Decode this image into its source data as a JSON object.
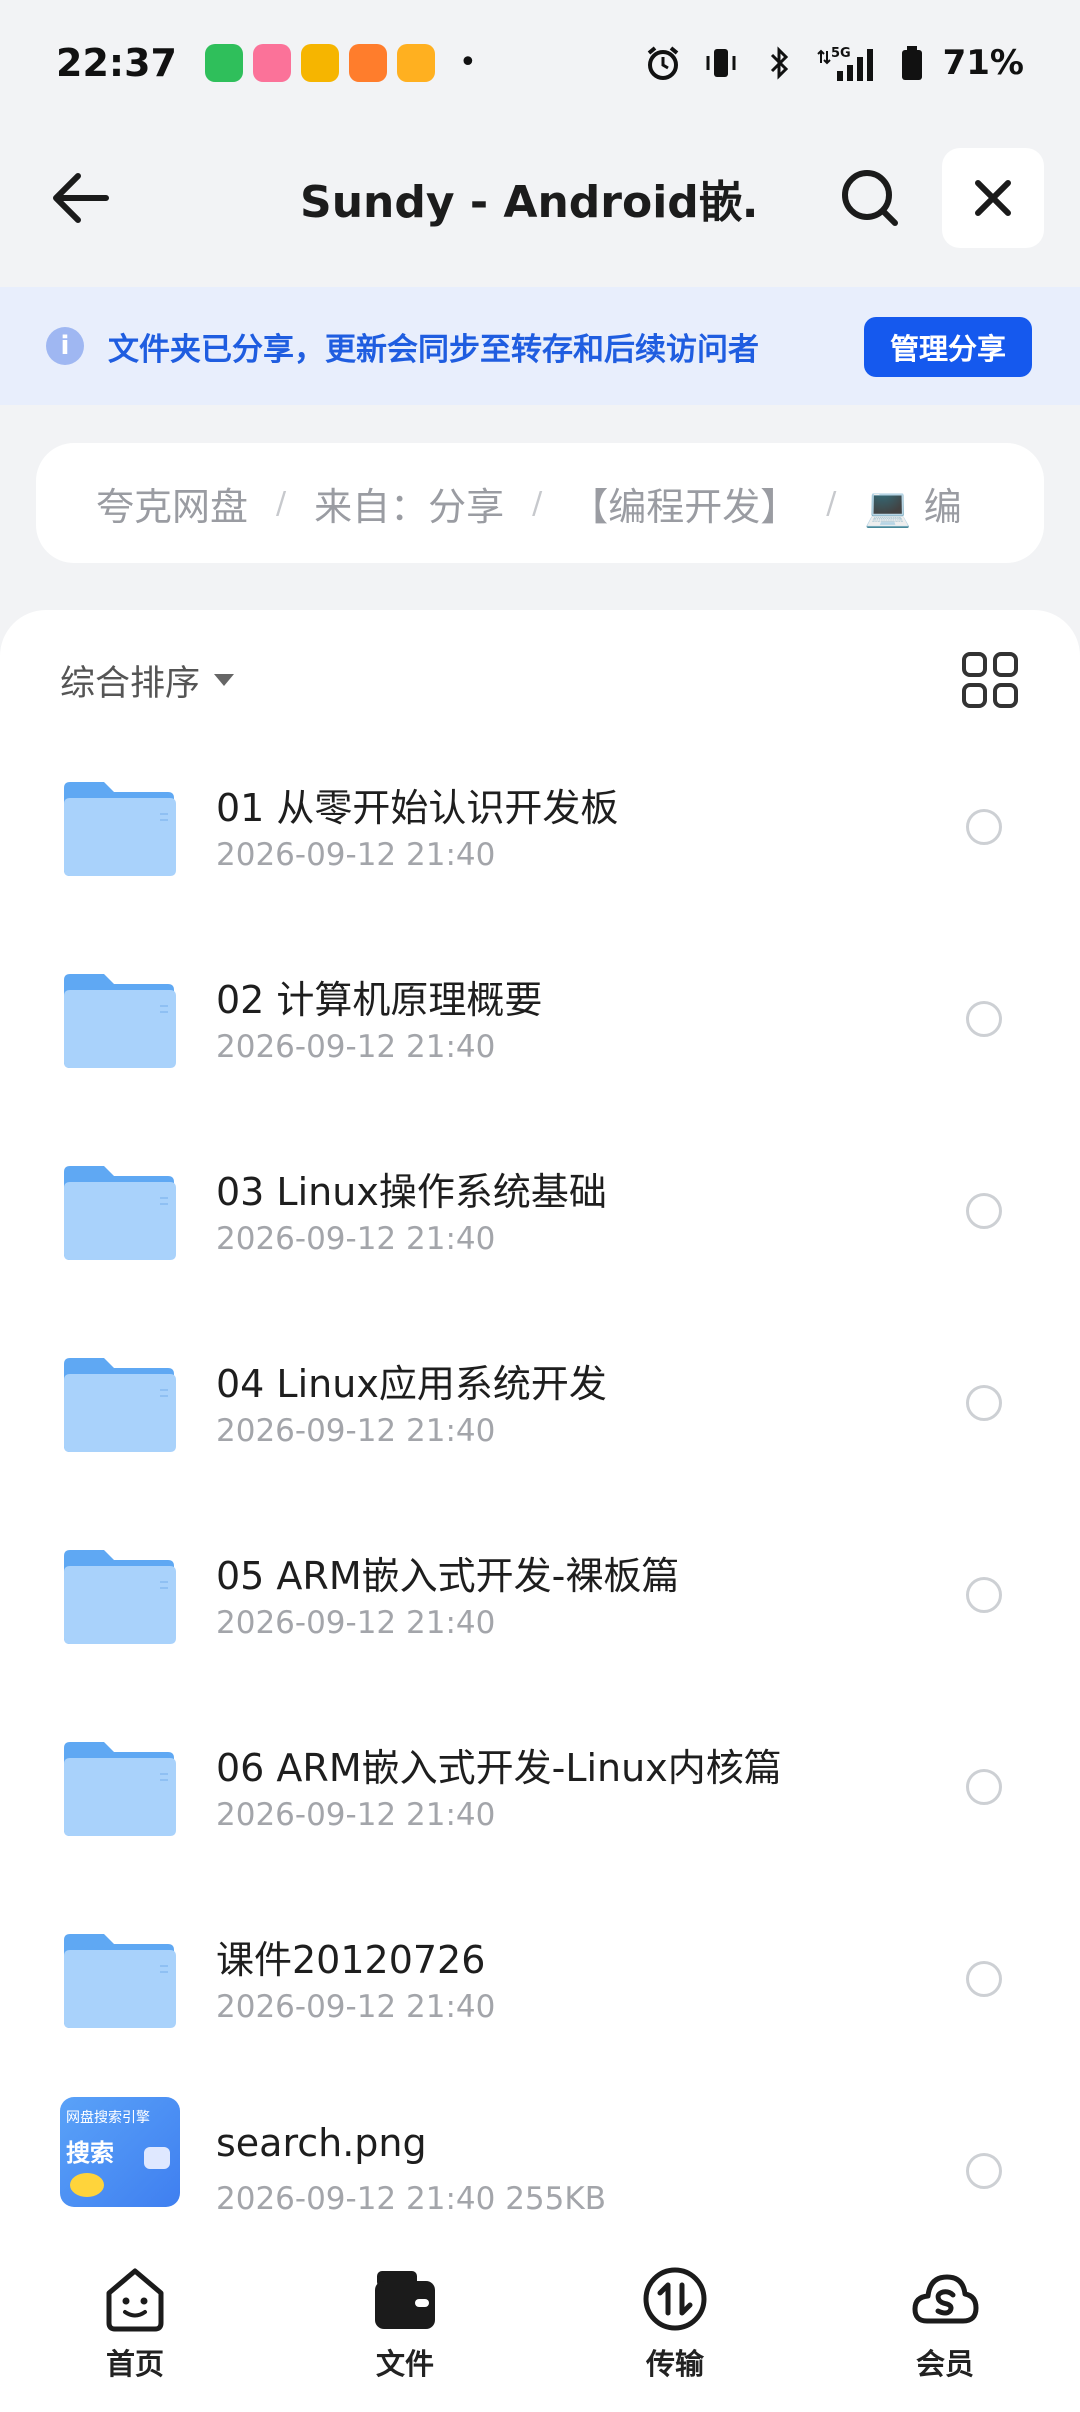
{
  "status_bar": {
    "time": "22:37",
    "battery": "71%",
    "network": "5G",
    "more": "•",
    "app_icons": [
      {
        "icon": "video-app-icon",
        "color": "#2fbf5b"
      },
      {
        "icon": "bilibili-app-icon",
        "color": "#fb7299"
      },
      {
        "icon": "fox-app-icon",
        "color": "#f6b500"
      },
      {
        "icon": "orange-app-icon",
        "color": "#ff7d2c"
      },
      {
        "icon": "play-app-icon",
        "color": "#ffb020"
      }
    ]
  },
  "nav": {
    "title": "Sundy - Android嵌…"
  },
  "share_banner": {
    "info_glyph": "i",
    "text": "文件夹已分享，更新会同步至转存和后续访问者",
    "manage_label": "管理分享"
  },
  "breadcrumb": {
    "items": [
      "夸克网盘",
      "来自：分享",
      "【编程开发】",
      "💻 编"
    ],
    "separator": "/"
  },
  "toolbar": {
    "sort_label": "综合排序"
  },
  "files": [
    {
      "name": "01 从零开始认识开发板",
      "meta": "2026-09-12 21:40",
      "type": "folder"
    },
    {
      "name": "02 计算机原理概要",
      "meta": "2026-09-12 21:40",
      "type": "folder"
    },
    {
      "name": "03 Linux操作系统基础",
      "meta": "2026-09-12 21:40",
      "type": "folder"
    },
    {
      "name": "04 Linux应用系统开发",
      "meta": "2026-09-12 21:40",
      "type": "folder"
    },
    {
      "name": "05 ARM嵌入式开发-裸板篇",
      "meta": "2026-09-12 21:40",
      "type": "folder"
    },
    {
      "name": "06 ARM嵌入式开发-Linux内核篇",
      "meta": "2026-09-12 21:40",
      "type": "folder"
    },
    {
      "name": "课件20120726",
      "meta": "2026-09-12 21:40",
      "type": "folder"
    },
    {
      "name": "search.png",
      "meta": "2026-09-12 21:40  255KB",
      "type": "image",
      "thumb_lines": [
        "网盘搜索引擎",
        "搜索"
      ]
    }
  ],
  "tabs": [
    {
      "label": "首页",
      "icon": "home-face-icon"
    },
    {
      "label": "文件",
      "icon": "wallet-folder-icon"
    },
    {
      "label": "传输",
      "icon": "transfer-arrows-icon"
    },
    {
      "label": "会员",
      "icon": "cloud-s-icon"
    }
  ],
  "colors": {
    "accent": "#1559ee",
    "banner_bg": "#e8eefc",
    "folder_light": "#a9d2fb",
    "folder_dark": "#5fa8f3"
  }
}
